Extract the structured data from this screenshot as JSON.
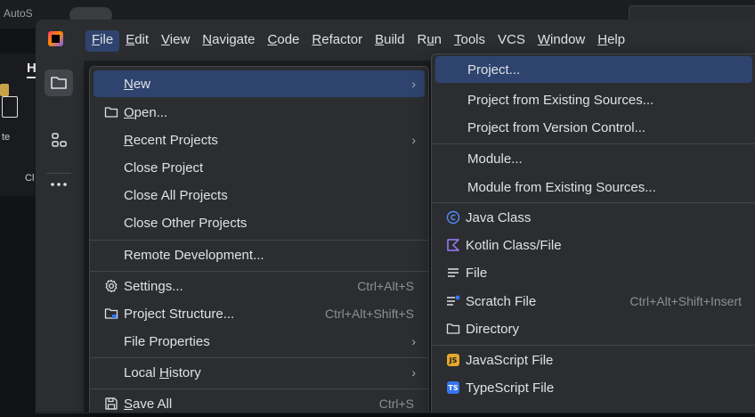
{
  "background_app": {
    "autosave_label": "AutoS",
    "home_tab": "H",
    "paste_label": "te",
    "clip_label": "Cl"
  },
  "menubar": [
    {
      "label": "File",
      "ul": "F"
    },
    {
      "label": "Edit",
      "ul": "E"
    },
    {
      "label": "View",
      "ul": "V"
    },
    {
      "label": "Navigate",
      "ul": "N"
    },
    {
      "label": "Code",
      "ul": "C"
    },
    {
      "label": "Refactor",
      "ul": "R"
    },
    {
      "label": "Build",
      "ul": "B"
    },
    {
      "label": "Run",
      "ul": "u"
    },
    {
      "label": "Tools",
      "ul": "T"
    },
    {
      "label": "VCS",
      "ul": ""
    },
    {
      "label": "Window",
      "ul": "W"
    },
    {
      "label": "Help",
      "ul": "H"
    }
  ],
  "file_menu": {
    "new": "New",
    "open": "Open...",
    "recent_projects": "Recent Projects",
    "close_project": "Close Project",
    "close_all_projects": "Close All Projects",
    "close_other_projects": "Close Other Projects",
    "remote_development": "Remote Development...",
    "settings": "Settings...",
    "settings_shortcut": "Ctrl+Alt+S",
    "project_structure": "Project Structure...",
    "project_structure_shortcut": "Ctrl+Alt+Shift+S",
    "file_properties": "File Properties",
    "local_history": "Local History",
    "save_all": "Save All",
    "save_all_shortcut": "Ctrl+S",
    "submenu_arrow": "›"
  },
  "new_submenu": {
    "project": "Project...",
    "project_existing": "Project from Existing Sources...",
    "project_vcs": "Project from Version Control...",
    "module": "Module...",
    "module_existing": "Module from Existing Sources...",
    "java_class": "Java Class",
    "kotlin_class": "Kotlin Class/File",
    "file": "File",
    "scratch_file": "Scratch File",
    "scratch_shortcut": "Ctrl+Alt+Shift+Insert",
    "directory": "Directory",
    "javascript_file": "JavaScript File",
    "typescript_file": "TypeScript File",
    "js_badge": "JS",
    "ts_badge": "TS"
  },
  "colors": {
    "highlight": "#2e436e",
    "menu_bg": "#2b2d30",
    "java_blue": "#548af7",
    "kotlin_purple": "#9d7bff",
    "js_yellow": "#e5a72d",
    "ts_blue": "#3574f0"
  }
}
